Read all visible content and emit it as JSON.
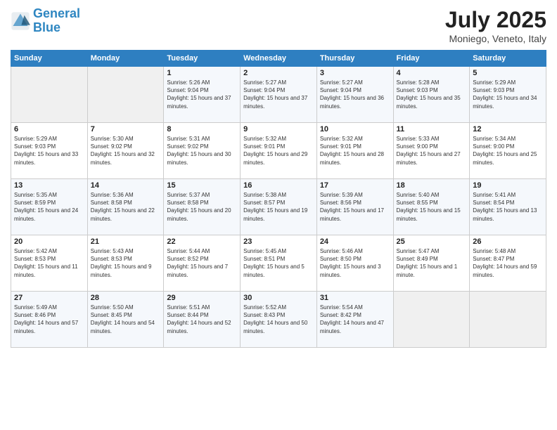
{
  "header": {
    "logo_line1": "General",
    "logo_line2": "Blue",
    "month": "July 2025",
    "location": "Moniego, Veneto, Italy"
  },
  "weekdays": [
    "Sunday",
    "Monday",
    "Tuesday",
    "Wednesday",
    "Thursday",
    "Friday",
    "Saturday"
  ],
  "weeks": [
    [
      {
        "day": "",
        "info": ""
      },
      {
        "day": "",
        "info": ""
      },
      {
        "day": "1",
        "info": "Sunrise: 5:26 AM\nSunset: 9:04 PM\nDaylight: 15 hours and 37 minutes."
      },
      {
        "day": "2",
        "info": "Sunrise: 5:27 AM\nSunset: 9:04 PM\nDaylight: 15 hours and 37 minutes."
      },
      {
        "day": "3",
        "info": "Sunrise: 5:27 AM\nSunset: 9:04 PM\nDaylight: 15 hours and 36 minutes."
      },
      {
        "day": "4",
        "info": "Sunrise: 5:28 AM\nSunset: 9:03 PM\nDaylight: 15 hours and 35 minutes."
      },
      {
        "day": "5",
        "info": "Sunrise: 5:29 AM\nSunset: 9:03 PM\nDaylight: 15 hours and 34 minutes."
      }
    ],
    [
      {
        "day": "6",
        "info": "Sunrise: 5:29 AM\nSunset: 9:03 PM\nDaylight: 15 hours and 33 minutes."
      },
      {
        "day": "7",
        "info": "Sunrise: 5:30 AM\nSunset: 9:02 PM\nDaylight: 15 hours and 32 minutes."
      },
      {
        "day": "8",
        "info": "Sunrise: 5:31 AM\nSunset: 9:02 PM\nDaylight: 15 hours and 30 minutes."
      },
      {
        "day": "9",
        "info": "Sunrise: 5:32 AM\nSunset: 9:01 PM\nDaylight: 15 hours and 29 minutes."
      },
      {
        "day": "10",
        "info": "Sunrise: 5:32 AM\nSunset: 9:01 PM\nDaylight: 15 hours and 28 minutes."
      },
      {
        "day": "11",
        "info": "Sunrise: 5:33 AM\nSunset: 9:00 PM\nDaylight: 15 hours and 27 minutes."
      },
      {
        "day": "12",
        "info": "Sunrise: 5:34 AM\nSunset: 9:00 PM\nDaylight: 15 hours and 25 minutes."
      }
    ],
    [
      {
        "day": "13",
        "info": "Sunrise: 5:35 AM\nSunset: 8:59 PM\nDaylight: 15 hours and 24 minutes."
      },
      {
        "day": "14",
        "info": "Sunrise: 5:36 AM\nSunset: 8:58 PM\nDaylight: 15 hours and 22 minutes."
      },
      {
        "day": "15",
        "info": "Sunrise: 5:37 AM\nSunset: 8:58 PM\nDaylight: 15 hours and 20 minutes."
      },
      {
        "day": "16",
        "info": "Sunrise: 5:38 AM\nSunset: 8:57 PM\nDaylight: 15 hours and 19 minutes."
      },
      {
        "day": "17",
        "info": "Sunrise: 5:39 AM\nSunset: 8:56 PM\nDaylight: 15 hours and 17 minutes."
      },
      {
        "day": "18",
        "info": "Sunrise: 5:40 AM\nSunset: 8:55 PM\nDaylight: 15 hours and 15 minutes."
      },
      {
        "day": "19",
        "info": "Sunrise: 5:41 AM\nSunset: 8:54 PM\nDaylight: 15 hours and 13 minutes."
      }
    ],
    [
      {
        "day": "20",
        "info": "Sunrise: 5:42 AM\nSunset: 8:53 PM\nDaylight: 15 hours and 11 minutes."
      },
      {
        "day": "21",
        "info": "Sunrise: 5:43 AM\nSunset: 8:53 PM\nDaylight: 15 hours and 9 minutes."
      },
      {
        "day": "22",
        "info": "Sunrise: 5:44 AM\nSunset: 8:52 PM\nDaylight: 15 hours and 7 minutes."
      },
      {
        "day": "23",
        "info": "Sunrise: 5:45 AM\nSunset: 8:51 PM\nDaylight: 15 hours and 5 minutes."
      },
      {
        "day": "24",
        "info": "Sunrise: 5:46 AM\nSunset: 8:50 PM\nDaylight: 15 hours and 3 minutes."
      },
      {
        "day": "25",
        "info": "Sunrise: 5:47 AM\nSunset: 8:49 PM\nDaylight: 15 hours and 1 minute."
      },
      {
        "day": "26",
        "info": "Sunrise: 5:48 AM\nSunset: 8:47 PM\nDaylight: 14 hours and 59 minutes."
      }
    ],
    [
      {
        "day": "27",
        "info": "Sunrise: 5:49 AM\nSunset: 8:46 PM\nDaylight: 14 hours and 57 minutes."
      },
      {
        "day": "28",
        "info": "Sunrise: 5:50 AM\nSunset: 8:45 PM\nDaylight: 14 hours and 54 minutes."
      },
      {
        "day": "29",
        "info": "Sunrise: 5:51 AM\nSunset: 8:44 PM\nDaylight: 14 hours and 52 minutes."
      },
      {
        "day": "30",
        "info": "Sunrise: 5:52 AM\nSunset: 8:43 PM\nDaylight: 14 hours and 50 minutes."
      },
      {
        "day": "31",
        "info": "Sunrise: 5:54 AM\nSunset: 8:42 PM\nDaylight: 14 hours and 47 minutes."
      },
      {
        "day": "",
        "info": ""
      },
      {
        "day": "",
        "info": ""
      }
    ]
  ]
}
